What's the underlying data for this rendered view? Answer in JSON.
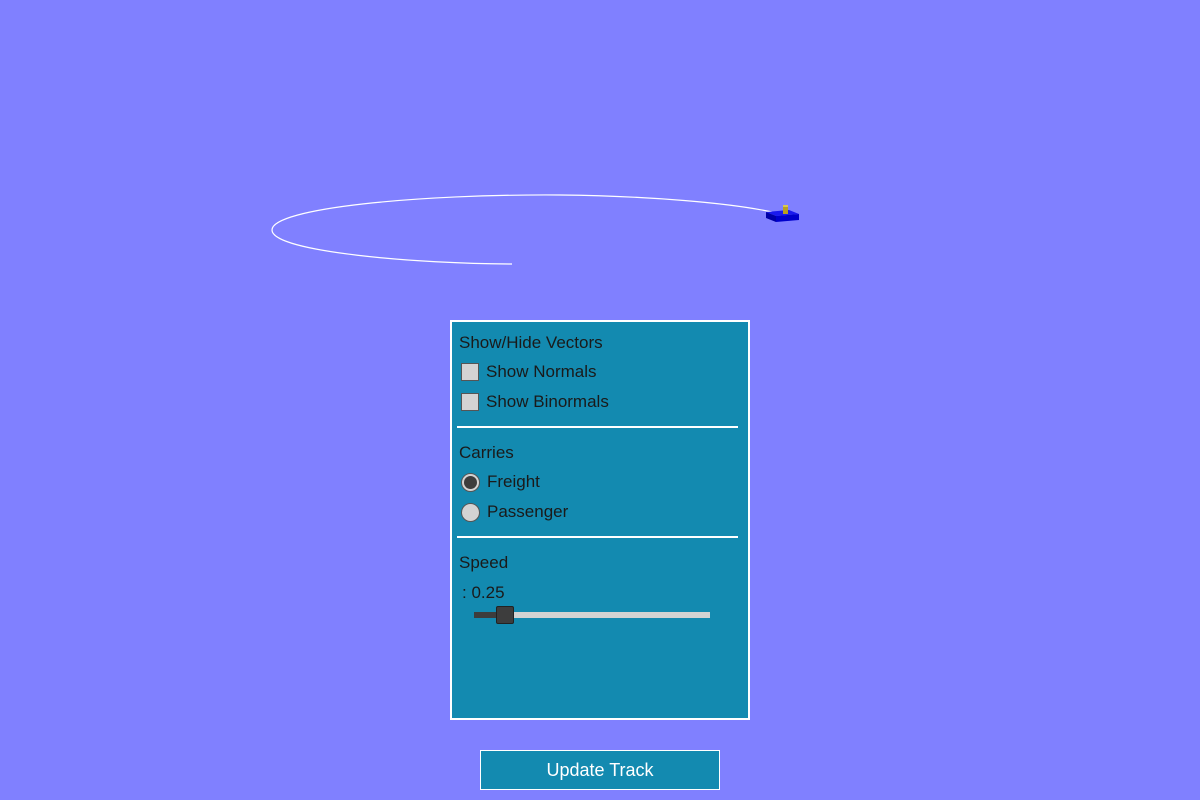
{
  "scene": {
    "background_color": "#8080ff",
    "track_color": "#ffffff",
    "train_color": "#0000cc",
    "cargo_color": "#b8a020"
  },
  "panel": {
    "vectors": {
      "title": "Show/Hide Vectors",
      "options": [
        {
          "label": "Show Normals",
          "checked": false
        },
        {
          "label": "Show Binormals",
          "checked": false
        }
      ]
    },
    "carries": {
      "title": "Carries",
      "options": [
        {
          "label": "Freight",
          "selected": true
        },
        {
          "label": "Passenger",
          "selected": false
        }
      ]
    },
    "speed": {
      "title": "Speed",
      "readout": ": 0.25",
      "value": 0.25,
      "min": 0,
      "max": 2
    }
  },
  "update_button": {
    "label": "Update Track"
  }
}
